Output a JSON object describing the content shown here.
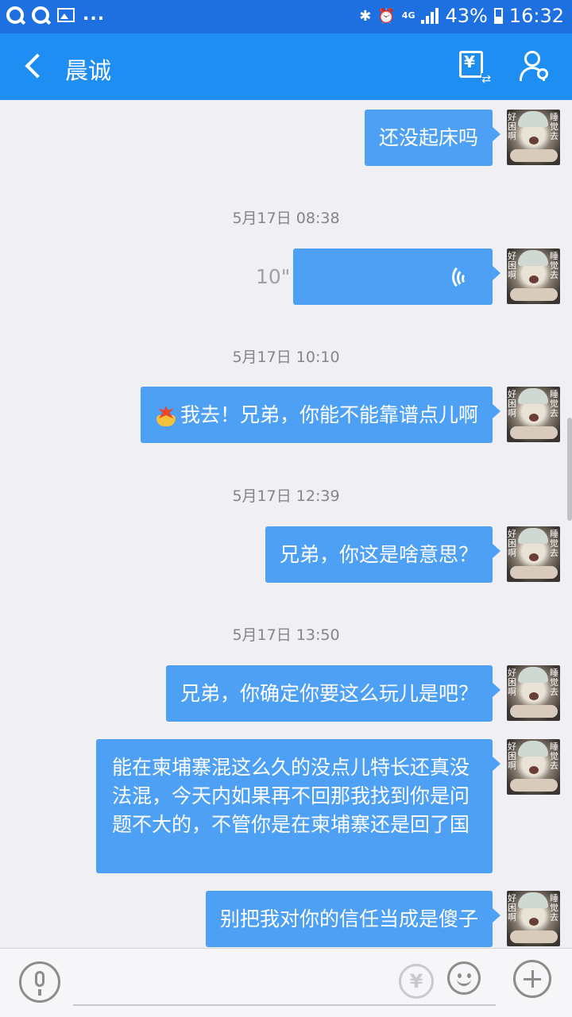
{
  "status_bar": {
    "overflow": "...",
    "network": "4G",
    "battery": "43%",
    "time": "16:32",
    "icons": [
      "qq-icon",
      "qq-icon",
      "image-icon",
      "bluetooth-icon",
      "alarm-icon",
      "signal-icon",
      "battery-icon"
    ]
  },
  "header": {
    "title": "晨诚",
    "transfer_icon": "yen-transfer-icon",
    "profile_icon": "profile-settings-icon"
  },
  "avatar": {
    "caption_left": "好困啊",
    "caption_right": "睡觉去"
  },
  "messages": [
    {
      "type": "text",
      "text": "还没起床吗"
    },
    {
      "type": "timestamp",
      "text": "5月17日 08:38"
    },
    {
      "type": "voice",
      "duration": "10\""
    },
    {
      "type": "timestamp",
      "text": "5月17日 10:10"
    },
    {
      "type": "text",
      "emoji": "burst-emoji-icon",
      "text": "我去！兄弟，你能不能靠谱点儿啊"
    },
    {
      "type": "timestamp",
      "text": "5月17日 12:39"
    },
    {
      "type": "text",
      "text": "兄弟，你这是啥意思？"
    },
    {
      "type": "timestamp",
      "text": "5月17日 13:50"
    },
    {
      "type": "text",
      "text": "兄弟，你确定你要这么玩儿是吧？"
    },
    {
      "type": "text",
      "text": "能在柬埔寨混这么久的没点儿特长还真没法混，今天内如果再不回那我找到你是问题不大的，不管你是在柬埔寨还是回了国"
    },
    {
      "type": "text",
      "text": "别把我对你的信任当成是傻子"
    }
  ],
  "input_bar": {
    "voice_icon": "microphone-icon",
    "input_value": "",
    "red_packet_label": "¥",
    "emoji_icon": "smiley-icon",
    "plus_icon": "plus-icon"
  },
  "colors": {
    "status_bar": "#1e6fe0",
    "title_bar": "#1e8ef3",
    "bubble": "#4ea0f5",
    "background": "#efeff4"
  }
}
